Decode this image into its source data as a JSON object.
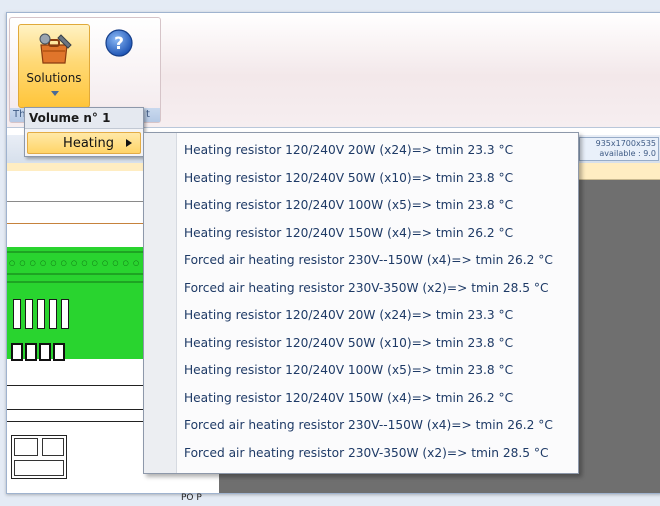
{
  "ribbon": {
    "solutions_label": "Solutions",
    "group_caption_left": "Th",
    "group_caption_right": "t",
    "help_icon": "help-question-icon"
  },
  "info_box": {
    "line1": "935x1700x535",
    "line2": "available : 9.0"
  },
  "menu_volume": {
    "header": "Volume n° 1",
    "item_label": "Heating"
  },
  "heating_menu": {
    "items": [
      "Heating resistor 120/240V  20W (x24)=> tmin 23.3 °C",
      "Heating resistor 120/240V  50W (x10)=> tmin 23.8 °C",
      "Heating resistor 120/240V  100W (x5)=> tmin 23.8 °C",
      "Heating resistor 120/240V  150W (x4)=> tmin 26.2 °C",
      "Forced air heating resistor 230V--150W (x4)=> tmin 26.2 °C",
      "Forced air heating resistor 230V-350W (x2)=> tmin 28.5 °C",
      "Heating resistor 120/240V  20W (x24)=> tmin 23.3 °C",
      "Heating resistor 120/240V  50W (x10)=> tmin 23.8 °C",
      "Heating resistor 120/240V  100W (x5)=> tmin 23.8 °C",
      "Heating resistor 120/240V  150W (x4)=> tmin 26.2 °C",
      "Forced air heating resistor 230V--150W (x4)=> tmin 26.2 °C",
      "Forced air heating resistor 230V-350W (x2)=> tmin 28.5 °C"
    ]
  },
  "canvas": {
    "label": "PO P"
  },
  "colors": {
    "accent": "#ffd468",
    "menu_text": "#1e3a66",
    "panel_green": "#29d42f",
    "canvas_gray": "#6f6f6f"
  }
}
